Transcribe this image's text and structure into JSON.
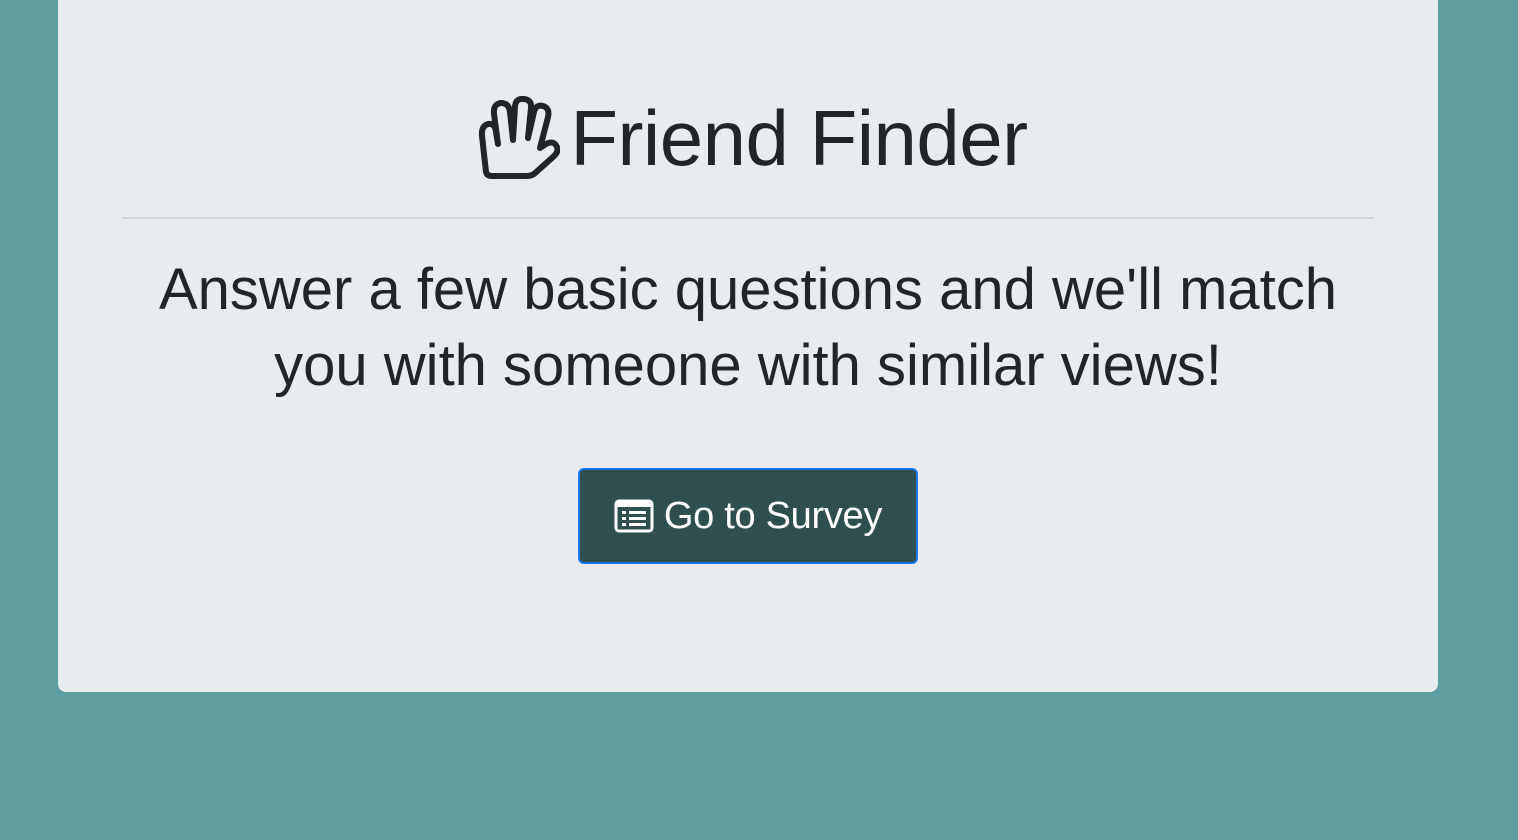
{
  "page": {
    "title": "Friend Finder",
    "lead": "Answer a few basic questions and we'll match you with someone with similar views!"
  },
  "survey_button": {
    "label": "Go to Survey",
    "icon": "list-alt-icon"
  },
  "icons": {
    "title_icon": "vulcan-salute-hand-icon"
  },
  "colors": {
    "background": "#5f9ea0",
    "panel": "#e8ecef",
    "button": "#2f4f4f",
    "button_border": "#1a73e8",
    "text": "#212529"
  }
}
